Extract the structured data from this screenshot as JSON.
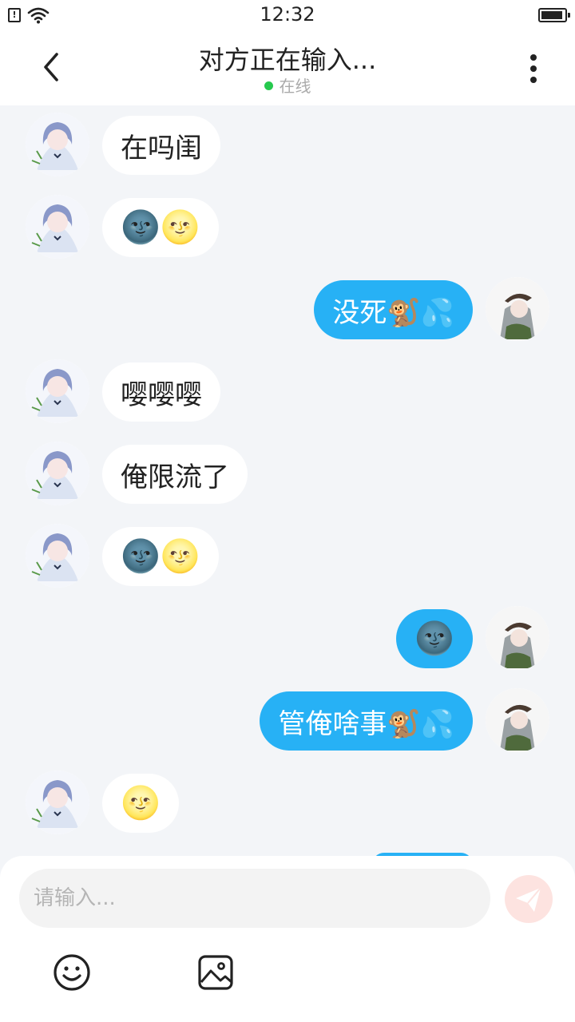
{
  "status_bar": {
    "time": "12:32",
    "sim_mark": "!"
  },
  "header": {
    "title": "对方正在输入...",
    "status": "在线"
  },
  "messages": [
    {
      "side": "left",
      "text": "在吗闺"
    },
    {
      "side": "left",
      "text": "🌚🌝"
    },
    {
      "side": "right",
      "text": "没死🐒💦"
    },
    {
      "side": "left",
      "text": "嘤嘤嘤"
    },
    {
      "side": "left",
      "text": "俺限流了"
    },
    {
      "side": "left",
      "text": "🌚🌝"
    },
    {
      "side": "right",
      "text": "🌚"
    },
    {
      "side": "right",
      "text": "管俺啥事🐒💦"
    },
    {
      "side": "left",
      "text": "🌝"
    }
  ],
  "composer": {
    "placeholder": "请输入..."
  },
  "icons": {
    "back": "chevron-left-icon",
    "more": "more-vertical-icon",
    "send": "paper-plane-icon",
    "emoji": "smiley-icon",
    "image": "image-icon"
  },
  "colors": {
    "own_bubble": "#27b1f5",
    "other_bubble": "#ffffff",
    "background": "#f3f5f8",
    "online": "#26c94e",
    "send_button": "#fde3e0"
  }
}
